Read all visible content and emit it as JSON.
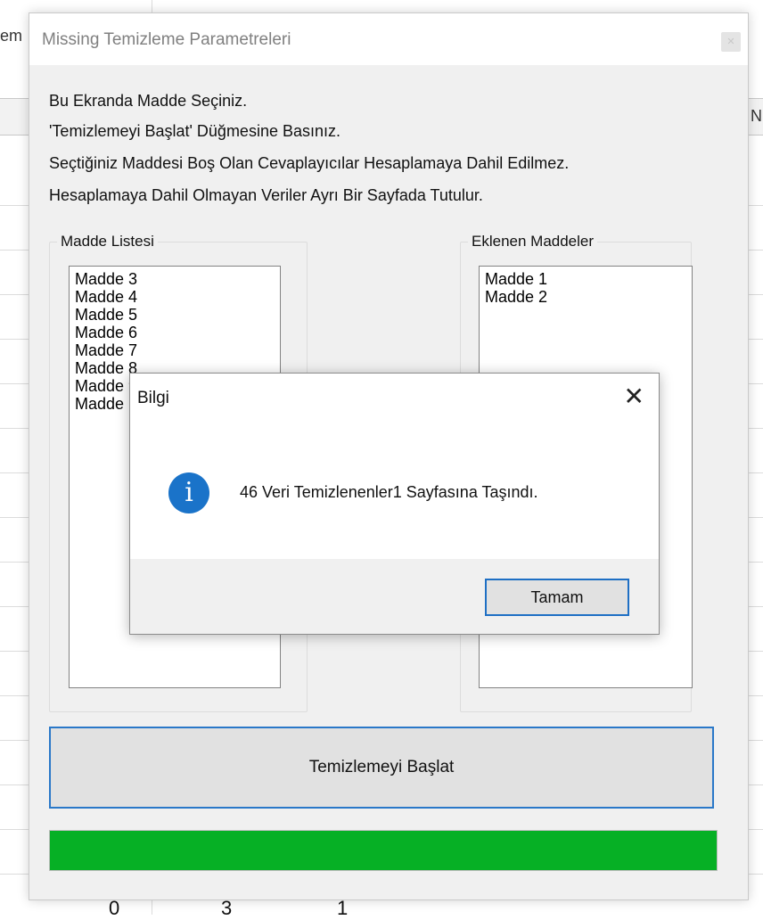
{
  "background_sheet": {
    "peek_left": "em",
    "peek_right": "N",
    "bottom_numbers": [
      "0",
      "3",
      "1"
    ]
  },
  "main_window": {
    "title": "Missing Temizleme Parametreleri",
    "instructions": [
      "Bu Ekranda Madde Seçiniz.",
      "'Temizlemeyi Başlat' Düğmesine Basınız.",
      "Seçtiğiniz Maddesi Boş Olan Cevaplayıcılar Hesaplamaya Dahil Edilmez.",
      "Hesaplamaya Dahil Olmayan Veriler Ayrı Bir Sayfada Tutulur."
    ],
    "madde_listesi": {
      "label": "Madde Listesi",
      "items": [
        "Madde 3",
        "Madde 4",
        "Madde 5",
        "Madde 6",
        "Madde 7",
        "Madde 8",
        "Madde 9",
        "Madde 10"
      ]
    },
    "eklenen_maddeler": {
      "label": "Eklenen Maddeler",
      "items": [
        "Madde 1",
        "Madde 2"
      ]
    },
    "start_button": "Temizlemeyi Başlat",
    "progress": 1.0,
    "progress_color": "#06b025"
  },
  "message_box": {
    "title": "Bilgi",
    "close_glyph": "✕",
    "icon": "info-icon",
    "icon_glyph": "i",
    "message": "46 Veri Temizlenenler1 Sayfasına Taşındı.",
    "ok_button": "Tamam",
    "accent_color": "#1a73c9"
  }
}
